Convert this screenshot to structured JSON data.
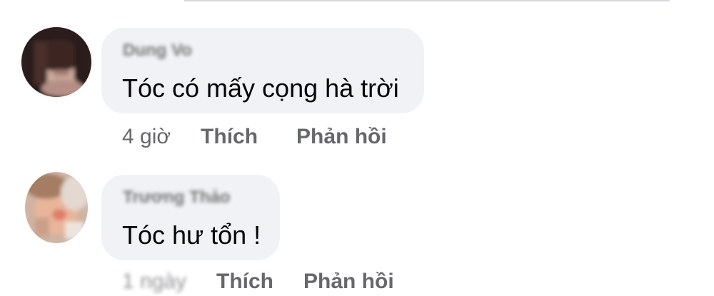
{
  "comments": [
    {
      "author": "Dung Vo",
      "text": "Tóc có mấy cọng hà trời",
      "time": "4 giờ",
      "like_label": "Thích",
      "reply_label": "Phản hồi"
    },
    {
      "author": "Trương Thảo",
      "text": "Tóc hư tổn !",
      "time": "1 ngày",
      "like_label": "Thích",
      "reply_label": "Phản hồi"
    }
  ],
  "icons": {
    "avatar_1": "avatar-blurred-photo",
    "avatar_2": "avatar-blurred-photo"
  },
  "colors": {
    "bubble_bg": "#f0f2f5",
    "text": "#050505",
    "meta": "#65676b"
  }
}
